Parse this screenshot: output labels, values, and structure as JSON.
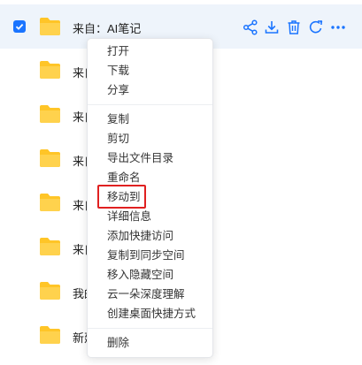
{
  "colors": {
    "accent": "#1a74ff",
    "folder": "#ffc527",
    "highlight": "#e02020"
  },
  "files": [
    {
      "name": "来自：AI笔记",
      "selected": true
    },
    {
      "name": "来自",
      "selected": false
    },
    {
      "name": "来自",
      "selected": false
    },
    {
      "name": "来自",
      "selected": false
    },
    {
      "name": "来自",
      "selected": false
    },
    {
      "name": "来自",
      "selected": false
    },
    {
      "name": "我的",
      "selected": false
    },
    {
      "name": "新建",
      "selected": false
    }
  ],
  "row_actions": [
    "share-icon",
    "download-icon",
    "delete-icon",
    "cloud-sync-icon",
    "more-icon"
  ],
  "context_menu": {
    "items": [
      {
        "label": "打开",
        "group": 1
      },
      {
        "label": "下载",
        "group": 1
      },
      {
        "label": "分享",
        "group": 1
      },
      {
        "label": "复制",
        "group": 2
      },
      {
        "label": "剪切",
        "group": 2
      },
      {
        "label": "导出文件目录",
        "group": 2
      },
      {
        "label": "重命名",
        "group": 2
      },
      {
        "label": "移动到",
        "group": 2,
        "highlighted": true
      },
      {
        "label": "详细信息",
        "group": 2
      },
      {
        "label": "添加快捷访问",
        "group": 2
      },
      {
        "label": "复制到同步空间",
        "group": 2
      },
      {
        "label": "移入隐藏空间",
        "group": 2
      },
      {
        "label": "云一朵深度理解",
        "group": 2
      },
      {
        "label": "创建桌面快捷方式",
        "group": 2
      },
      {
        "label": "删除",
        "group": 3
      }
    ]
  }
}
